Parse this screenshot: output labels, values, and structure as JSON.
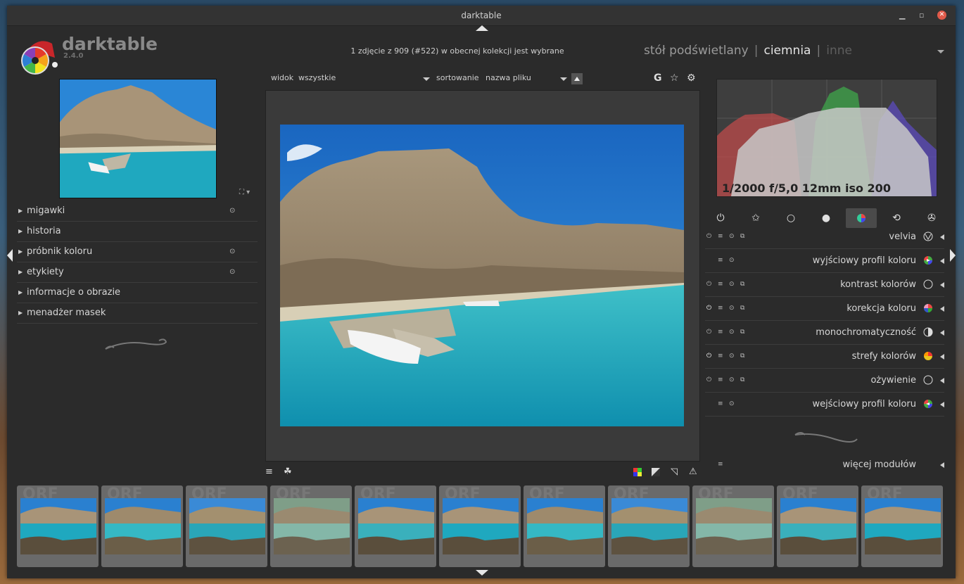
{
  "window": {
    "title": "darktable"
  },
  "app": {
    "name": "darktable",
    "version": "2.4.0"
  },
  "header": {
    "selection_msg": "1 zdjęcie z 909 (#522) w obecnej kolekcji jest wybrane",
    "views": [
      {
        "label": "stół podświetlany",
        "state": "inactive"
      },
      {
        "label": "ciemnia",
        "state": "active"
      },
      {
        "label": "inne",
        "state": "dim"
      }
    ],
    "separator": "|"
  },
  "left_panel": {
    "items": [
      {
        "label": "migawki",
        "has_preset": true
      },
      {
        "label": "historia",
        "has_preset": false
      },
      {
        "label": "próbnik koloru",
        "has_preset": true
      },
      {
        "label": "etykiety",
        "has_preset": true
      },
      {
        "label": "informacje o obrazie",
        "has_preset": false
      },
      {
        "label": "menadżer masek",
        "has_preset": false
      }
    ]
  },
  "center_top": {
    "view_label": "widok",
    "view_value": "wszystkie",
    "sort_label": "sortowanie",
    "sort_value": "nazwa pliku",
    "icons": [
      "grouping-icon",
      "star-icon",
      "gear-icon"
    ],
    "grouping_letter": "G"
  },
  "center_bottom": {
    "left_icons": [
      "presets-menu-icon",
      "styles-icon"
    ],
    "right_icons": [
      "gamut-check-icon",
      "softproof-icon",
      "overexposed-icon",
      "raw-overexposed-icon"
    ]
  },
  "histogram": {
    "exif": "1/2000 f/5,0 12mm iso 200"
  },
  "module_groups": [
    "power-icon",
    "star-icon",
    "circle-icon",
    "grey-circle-icon",
    "color-circle-icon",
    "rotate-icon",
    "aperture-icon"
  ],
  "modules": [
    {
      "label": "velvia",
      "power": true,
      "icon": "velvia-icon"
    },
    {
      "label": "wyjściowy profil koloru",
      "power": false,
      "icon": "output-profile-icon"
    },
    {
      "label": "kontrast kolorów",
      "power": true,
      "icon": "contrast-icon"
    },
    {
      "label": "korekcja koloru",
      "power": true,
      "icon": "color-correction-icon"
    },
    {
      "label": "monochromatyczność",
      "power": true,
      "icon": "monochrome-icon"
    },
    {
      "label": "strefy kolorów",
      "power": true,
      "icon": "color-zones-icon"
    },
    {
      "label": "ożywienie",
      "power": true,
      "icon": "vibrance-icon"
    },
    {
      "label": "wejściowy profil koloru",
      "power": false,
      "icon": "input-profile-icon"
    }
  ],
  "more_modules": {
    "label": "więcej modułów"
  },
  "filmstrip": {
    "tag": "ORF",
    "thumbs": [
      1,
      2,
      3,
      4,
      5,
      6,
      7,
      8,
      9,
      10,
      11
    ]
  },
  "colors": {
    "panel_bg": "#2b2b2b",
    "accent_close": "#e05a4a",
    "sea": "#1fa8bf",
    "sky": "#1e76c8"
  }
}
